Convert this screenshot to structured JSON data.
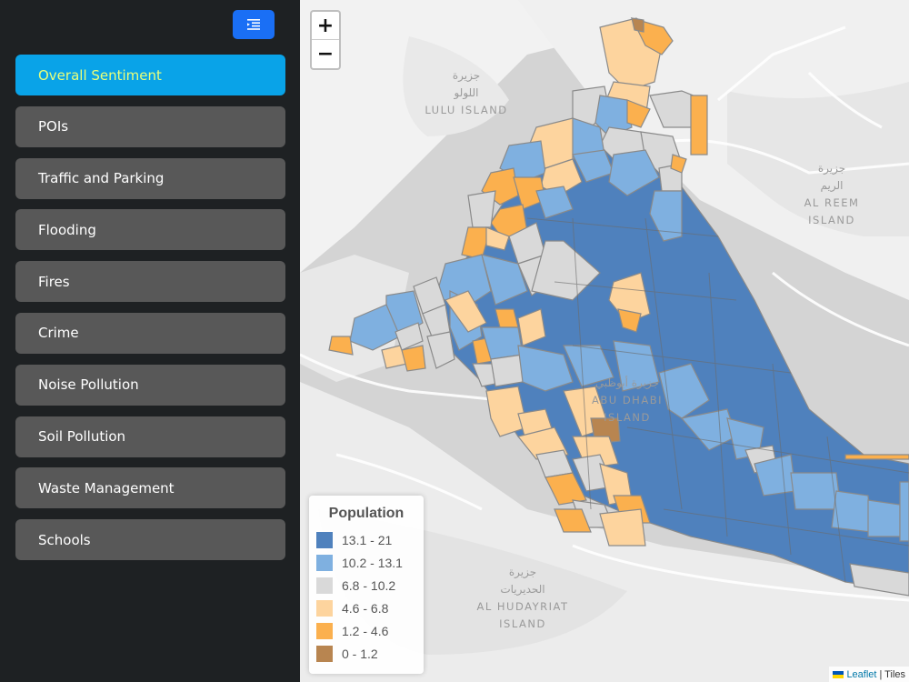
{
  "sidebar": {
    "toggle_icon": "menu-collapse-icon",
    "items": [
      {
        "label": "Overall Sentiment",
        "active": true
      },
      {
        "label": "POIs",
        "active": false
      },
      {
        "label": "Traffic and Parking",
        "active": false
      },
      {
        "label": "Flooding",
        "active": false
      },
      {
        "label": "Fires",
        "active": false
      },
      {
        "label": "Crime",
        "active": false
      },
      {
        "label": "Noise Pollution",
        "active": false
      },
      {
        "label": "Soil Pollution",
        "active": false
      },
      {
        "label": "Waste Management",
        "active": false
      },
      {
        "label": "Schools",
        "active": false
      }
    ]
  },
  "map": {
    "zoom_in": "+",
    "zoom_out": "−",
    "places": [
      {
        "ar1": "جزيرة",
        "ar2": "اللولو",
        "en1": "LULU ISLAND",
        "en2": ""
      },
      {
        "ar1": "جزيرة",
        "ar2": "الريم",
        "en1": "AL REEM",
        "en2": "ISLAND"
      },
      {
        "ar1": "جزيرة أبوظبي",
        "ar2": "",
        "en1": "ABU DHABI",
        "en2": "ISLAND"
      },
      {
        "ar1": "جزيرة",
        "ar2": "الحديريات",
        "en1": "AL HUDAYRIAT",
        "en2": "ISLAND"
      }
    ],
    "legend": {
      "title": "Population",
      "items": [
        {
          "label": "13.1 - 21",
          "color": "#4f81bd"
        },
        {
          "label": "10.2 - 13.1",
          "color": "#7fb0e0"
        },
        {
          "label": "6.8 - 10.2",
          "color": "#d9d9d9"
        },
        {
          "label": "4.6 - 6.8",
          "color": "#fdd49e"
        },
        {
          "label": "1.2 - 4.6",
          "color": "#fbb04e"
        },
        {
          "label": "0 - 1.2",
          "color": "#b88550"
        }
      ]
    },
    "attribution": {
      "link": "Leaflet",
      "rest": "| Tiles"
    }
  }
}
